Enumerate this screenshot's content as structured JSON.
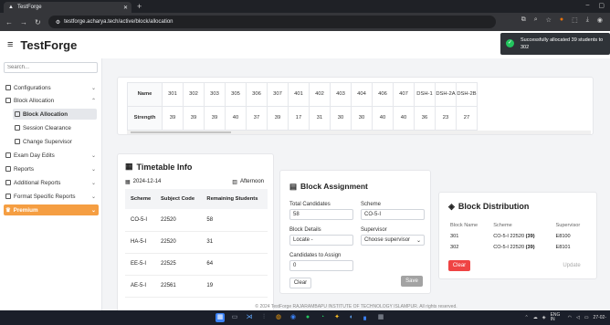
{
  "browser": {
    "tab_title": "TestForge",
    "url": "testforge.acharya.tech/active/block/allocation"
  },
  "app": {
    "brand": "TestForge"
  },
  "toast": {
    "message": "Successfully allocated 39 students to 302"
  },
  "sidebar": {
    "search_placeholder": "Search...",
    "items": [
      {
        "label": "Configurations"
      },
      {
        "label": "Block Allocation"
      },
      {
        "label": "Block Allocation"
      },
      {
        "label": "Session Clearance"
      },
      {
        "label": "Change Supervisor"
      },
      {
        "label": "Exam Day Edits"
      },
      {
        "label": "Reports"
      },
      {
        "label": "Additional Reports"
      },
      {
        "label": "Format Specific Reports"
      },
      {
        "label": "Premium"
      }
    ]
  },
  "allocation": {
    "row1_label": "Name",
    "row2_label": "Strength",
    "names": [
      "301",
      "302",
      "303",
      "305",
      "306",
      "307",
      "401",
      "402",
      "403",
      "404",
      "406",
      "407",
      "DSH-1",
      "DSH-2A",
      "DSH-2B"
    ],
    "strengths": [
      "39",
      "39",
      "39",
      "40",
      "37",
      "39",
      "17",
      "31",
      "30",
      "30",
      "40",
      "40",
      "36",
      "23",
      "27"
    ]
  },
  "timetable": {
    "title": "Timetable Info",
    "date": "2024-12-14",
    "shift": "Afternoon",
    "headers": [
      "Scheme",
      "Subject Code",
      "Remaining Students"
    ],
    "rows": [
      {
        "scheme": "CO-5-I",
        "code": "22520",
        "remaining": "58"
      },
      {
        "scheme": "HA-5-I",
        "code": "22520",
        "remaining": "31"
      },
      {
        "scheme": "EE-5-I",
        "code": "22525",
        "remaining": "64"
      },
      {
        "scheme": "AE-5-I",
        "code": "22561",
        "remaining": "19"
      }
    ]
  },
  "block_assignment": {
    "title": "Block Assignment",
    "total_label": "Total Candidates",
    "total_value": "58",
    "scheme_label": "Scheme",
    "scheme_value": "CO-5-I",
    "block_label": "Block Details",
    "block_value": "Locate -",
    "supervisor_label": "Supervisor",
    "supervisor_value": "Choose supervisor",
    "assign_label": "Candidates to Assign",
    "assign_value": "0",
    "clear": "Clear",
    "save": "Save"
  },
  "block_distribution": {
    "title": "Block Distribution",
    "headers": [
      "Block Name",
      "Scheme",
      "Supervisor"
    ],
    "rows": [
      {
        "block": "301",
        "scheme": "CO-5-I 22520",
        "count": "(39)",
        "supervisor": "E8100"
      },
      {
        "block": "302",
        "scheme": "CO-5-I 22520",
        "count": "(39)",
        "supervisor": "E8101"
      }
    ],
    "clear": "Clear",
    "update": "Update"
  },
  "footer": "© 2024 TestForge RAJARAMBAPU INSTITUTE OF TECHNOLOGY ISLAMPUR. All rights reserved.",
  "taskbar": {
    "tray_lang": "ENG IN",
    "tray_date": "27-02-"
  },
  "colors": {
    "accent": "#f59e42",
    "danger": "#ef4444",
    "success": "#22c55e"
  }
}
